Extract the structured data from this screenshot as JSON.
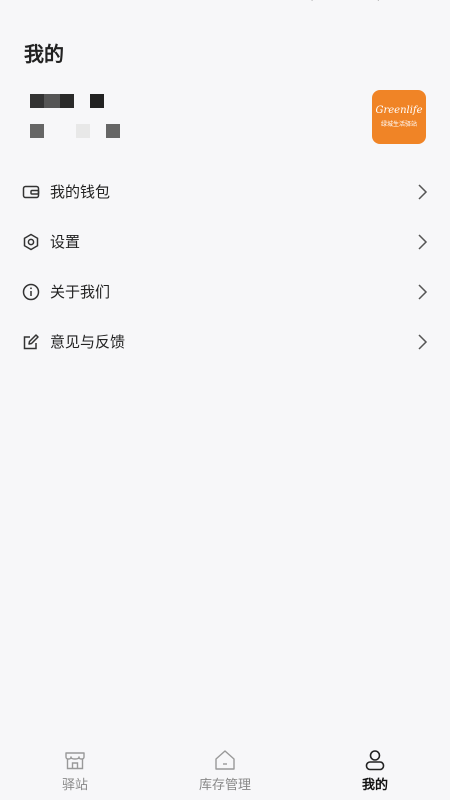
{
  "header": {
    "title": "我的"
  },
  "profile": {
    "logo_text": "Greenlife",
    "logo_subtext": "绿城生活驿站"
  },
  "menu": {
    "items": [
      {
        "label": "我的钱包",
        "icon": "wallet-icon"
      },
      {
        "label": "设置",
        "icon": "settings-icon"
      },
      {
        "label": "关于我们",
        "icon": "info-icon"
      },
      {
        "label": "意见与反馈",
        "icon": "edit-icon"
      }
    ]
  },
  "tabbar": {
    "tabs": [
      {
        "label": "驿站",
        "icon": "store-icon",
        "active": false
      },
      {
        "label": "库存管理",
        "icon": "home-icon",
        "active": false
      },
      {
        "label": "我的",
        "icon": "user-icon",
        "active": true
      }
    ]
  },
  "colors": {
    "accent": "#f08426",
    "text": "#222222",
    "muted": "#888888",
    "background": "#f7f7f9"
  }
}
